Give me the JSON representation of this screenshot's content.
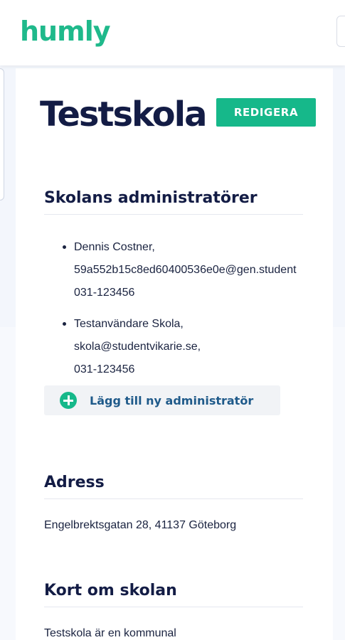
{
  "brand": {
    "logo_text": "humly",
    "accent": "#16b88a",
    "navy": "#131c45"
  },
  "school": {
    "name": "Testskola",
    "edit_label": "REDIGERA"
  },
  "admins": {
    "heading": "Skolans administratörer",
    "items": [
      {
        "name": "Dennis Costner,",
        "email": "59a552b15c8ed60400536e0e@gen.student",
        "phone": "031-123456"
      },
      {
        "name": "Testanvändare Skola,",
        "email": "skola@studentvikarie.se,",
        "phone": "031-123456"
      }
    ],
    "add_label": "Lägg till ny administratör",
    "add_icon": "plus-circle-icon"
  },
  "address": {
    "heading": "Adress",
    "value": "Engelbrektsgatan 28, 41137 Göteborg"
  },
  "about": {
    "heading": "Kort om skolan",
    "text": "Testskola är en kommunal"
  }
}
